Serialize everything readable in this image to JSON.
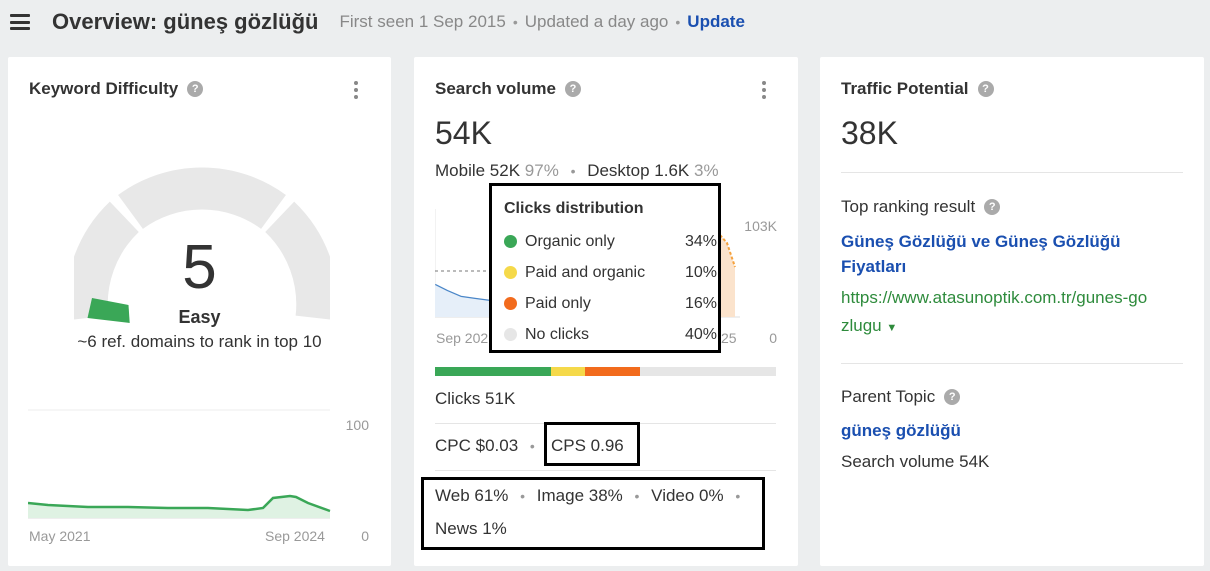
{
  "header": {
    "title": "Overview: güneş gözlüğü",
    "first_seen": "First seen 1 Sep 2015",
    "updated": "Updated a day ago",
    "update_link": "Update"
  },
  "kd_card": {
    "title": "Keyword Difficulty",
    "help": "?",
    "value": "5",
    "label": "Easy",
    "ref_domains": "~6 ref. domains to rank in top 10",
    "gauge_level": 0.05,
    "chart": {
      "y_max_label": "100",
      "y_min_label": "0",
      "x_start_label": "May 2021",
      "x_end_label": "Sep 2024"
    }
  },
  "sv_card": {
    "title": "Search volume",
    "help": "?",
    "value": "54K",
    "mobile_label": "Mobile 52K",
    "mobile_pct": "97%",
    "desktop_label": "Desktop 1.6K",
    "desktop_pct": "3%",
    "chart": {
      "y_max_label": "103K",
      "y_min_label": "0",
      "x_start_label": "Sep 202",
      "x_end_label": "25"
    },
    "tooltip": {
      "title": "Clicks distribution",
      "rows": [
        {
          "name": "Organic only",
          "pct": "34%",
          "color": "#3aa757"
        },
        {
          "name": "Paid and organic",
          "pct": "10%",
          "color": "#f5d94a"
        },
        {
          "name": "Paid only",
          "pct": "16%",
          "color": "#f26b1d"
        },
        {
          "name": "No clicks",
          "pct": "40%",
          "color": "#e6e6e6"
        }
      ]
    },
    "clicks": "Clicks 51K",
    "cpc": "CPC $0.03",
    "cps": "CPS 0.96",
    "serp_line1": {
      "web": "Web 61%",
      "image": "Image 38%",
      "video": "Video 0%"
    },
    "serp_line2": "News 1%"
  },
  "tp_card": {
    "title": "Traffic Potential",
    "help": "?",
    "value": "38K",
    "top_ranking_label": "Top ranking result",
    "top_ranking_title_1": "Güneş Gözlüğü ve Güneş Gözlüğü",
    "top_ranking_title_2": "Fiyatları",
    "url_1": "https://www.atasunoptik.com.tr/gunes-go",
    "url_2": "zlugu",
    "caret": "▼",
    "parent_topic_label": "Parent Topic",
    "parent_topic": "güneş gözlüğü",
    "parent_sv": "Search volume 54K"
  },
  "colors": {
    "accent_blue": "#1a4fb0",
    "green": "#3aa757",
    "url_green": "#2e8b3c"
  }
}
